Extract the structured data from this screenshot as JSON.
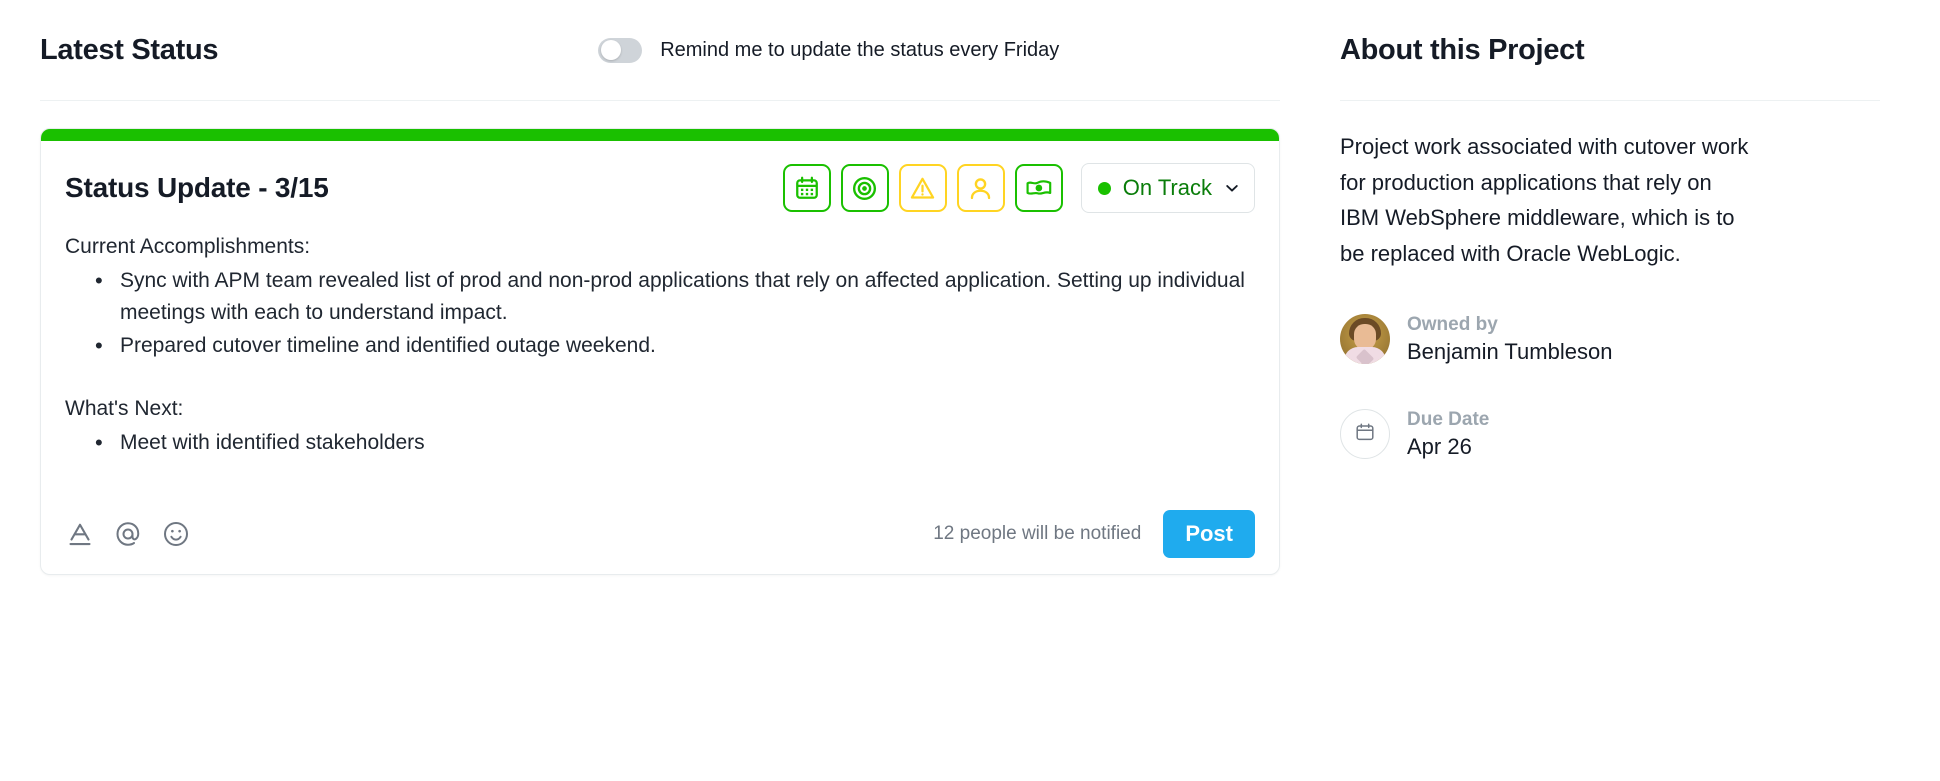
{
  "left": {
    "section_title": "Latest Status",
    "reminder": {
      "label": "Remind me to update the status every Friday",
      "toggle_state": "off"
    },
    "card": {
      "accent_color": "#1ac000",
      "title": "Status Update - 3/15",
      "chips": [
        {
          "name": "calendar-icon",
          "color": "#1ac000",
          "tone": "green"
        },
        {
          "name": "target-icon",
          "color": "#1ac000",
          "tone": "green"
        },
        {
          "name": "warning-icon",
          "color": "#ffd422",
          "tone": "yellow"
        },
        {
          "name": "person-icon",
          "color": "#ffd422",
          "tone": "yellow"
        },
        {
          "name": "money-icon",
          "color": "#1ac000",
          "tone": "green"
        }
      ],
      "status": {
        "label": "On Track",
        "dot_color": "#1ac000",
        "text_color": "#0a7d0a"
      },
      "body": {
        "heading_1": "Current Accomplishments:",
        "bullets_1": [
          "Sync with APM team revealed list of prod and non-prod applications that rely on affected application. Setting up individual meetings with each to understand impact.",
          "Prepared cutover timeline and identified outage weekend."
        ],
        "heading_2": "What's Next:",
        "bullets_2": [
          "Meet with identified stakeholders"
        ]
      },
      "footer": {
        "icons": [
          "text-format-icon",
          "mention-icon",
          "emoji-icon"
        ],
        "notified_text": "12 people will be notified",
        "post_label": "Post",
        "post_color": "#1fabee"
      }
    }
  },
  "right": {
    "section_title": "About this Project",
    "description": "Project work associated with cutover work for production applications that rely on IBM WebSphere middleware, which is to be replaced with Oracle WebLogic.",
    "owner": {
      "label": "Owned by",
      "value": "Benjamin Tumbleson"
    },
    "due_date": {
      "label": "Due Date",
      "value": "Apr 26"
    }
  }
}
